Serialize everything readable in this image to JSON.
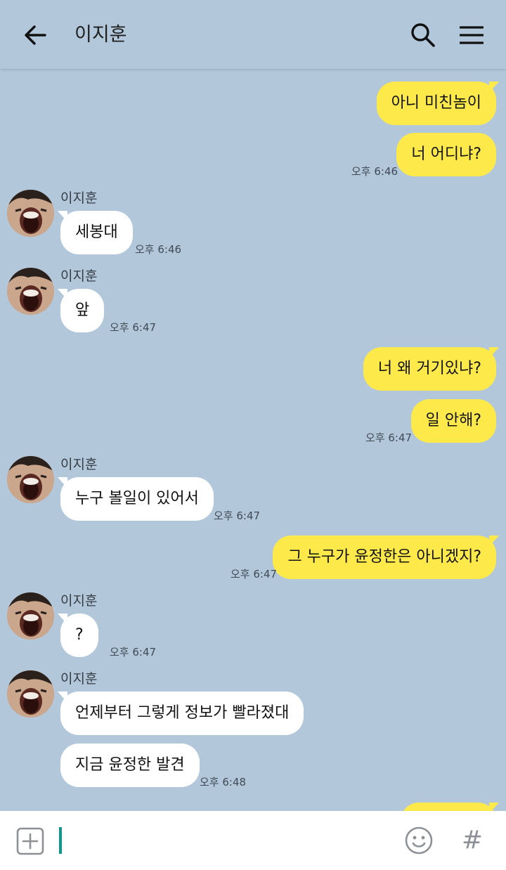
{
  "header": {
    "back_icon": "arrow-left-icon",
    "title": "이지훈",
    "search_icon": "search-icon",
    "menu_icon": "hamburger-menu-icon"
  },
  "colors": {
    "background": "#b2c7da",
    "my_bubble": "#fee94b",
    "their_bubble": "#ffffff",
    "caret": "#11958a"
  },
  "messages": [
    {
      "from": "me",
      "text": "아니 미친놈이"
    },
    {
      "from": "me",
      "text": "너 어디냐?",
      "time": "오후 6:46"
    },
    {
      "from": "이지훈",
      "sender": "이지훈",
      "text": "세봉대",
      "time": "오후 6:46"
    },
    {
      "from": "이지훈",
      "sender": "이지훈",
      "text": "앞",
      "time": "오후 6:47"
    },
    {
      "from": "me",
      "text": "너 왜 거기있냐?"
    },
    {
      "from": "me",
      "text": "일 안해?",
      "time": "오후 6:47"
    },
    {
      "from": "이지훈",
      "sender": "이지훈",
      "text": "누구 볼일이 있어서",
      "time": "오후 6:47"
    },
    {
      "from": "me",
      "text": "그 누구가 윤정한은 아니겠지?",
      "time": "오후 6:47"
    },
    {
      "from": "이지훈",
      "sender": "이지훈",
      "text": "?",
      "time": "오후 6:47"
    },
    {
      "from": "이지훈",
      "sender": "이지훈",
      "text": "언제부터 그렇게 정보가 빨라졌대"
    },
    {
      "from": "이지훈",
      "text": "지금 윤정한 발견",
      "time": "오후 6:48"
    },
    {
      "from": "me",
      "text": ""
    }
  ],
  "input_bar": {
    "plus_icon": "plus-square-icon",
    "value": "",
    "emoji_icon": "smiley-icon",
    "hash_label": "#"
  }
}
